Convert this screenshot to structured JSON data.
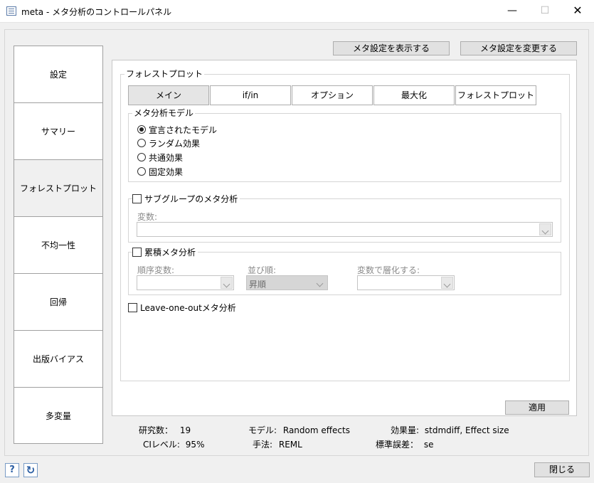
{
  "window": {
    "title": "meta - メタ分析のコントロールパネル",
    "minimize": "—",
    "maximize": "☐",
    "close": "✕"
  },
  "sidebar": {
    "items": [
      {
        "label": "設定"
      },
      {
        "label": "サマリー"
      },
      {
        "label": "フォレストプロット",
        "active": true
      },
      {
        "label": "不均一性"
      },
      {
        "label": "回帰"
      },
      {
        "label": "出版バイアス"
      },
      {
        "label": "多変量"
      }
    ]
  },
  "toolbar": {
    "show_settings": "メタ設定を表示する",
    "change_settings": "メタ設定を変更する"
  },
  "forest": {
    "group_label": "フォレストプロット",
    "tabs": [
      {
        "label": "メイン",
        "active": true
      },
      {
        "label": "if/in"
      },
      {
        "label": "オプション"
      },
      {
        "label": "最大化"
      },
      {
        "label": "フォレストプロット"
      }
    ],
    "model_group": "メタ分析モデル",
    "models": [
      {
        "label": "宣言されたモデル",
        "checked": true
      },
      {
        "label": "ランダム効果"
      },
      {
        "label": "共通効果"
      },
      {
        "label": "固定効果"
      }
    ],
    "subgroup": {
      "label": "サブグループのメタ分析",
      "variable_label": "変数:"
    },
    "cumulative": {
      "label": "累積メタ分析",
      "order_var_label": "順序変数:",
      "sort_label": "並び順:",
      "sort_value": "昇順",
      "stratify_label": "変数で層化する:"
    },
    "leave_one_out": "Leave-one-outメタ分析"
  },
  "apply": "適用",
  "summary": {
    "studies_label": "研究数：",
    "studies_value": "19",
    "model_label": "モデル:",
    "model_value": "Random effects",
    "effect_label": "効果量:",
    "effect_value": "stdmdiff, Effect size",
    "ci_label": "CIレベル:",
    "ci_value": "95%",
    "method_label": "手法:",
    "method_value": "REML",
    "se_label": "標準誤差：",
    "se_value": "se"
  },
  "footer": {
    "help": "?",
    "refresh": "↻",
    "close": "閉じる"
  }
}
